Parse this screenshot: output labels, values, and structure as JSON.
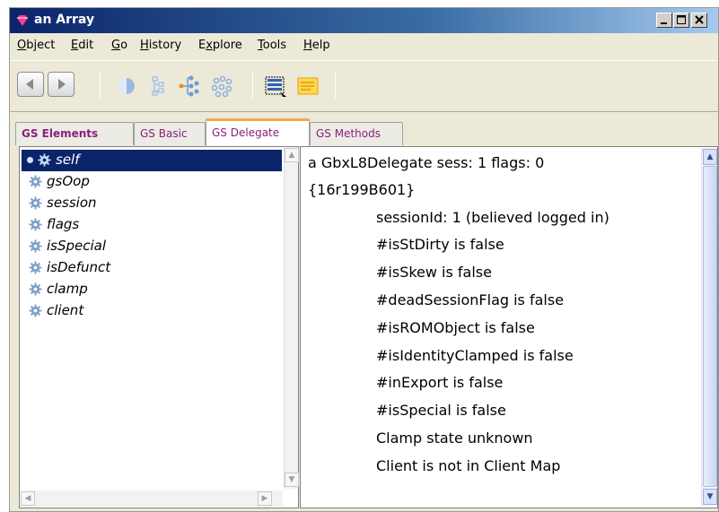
{
  "window": {
    "title": "an Array",
    "controls": {
      "minimize": "_",
      "maximize": "□",
      "close": "X"
    }
  },
  "menu": [
    {
      "label": "Object",
      "mnemonic": "O",
      "rest": "bject"
    },
    {
      "label": "Edit",
      "mnemonic": "E",
      "rest": "dit"
    },
    {
      "label": "Go",
      "mnemonic": "G",
      "rest": "o"
    },
    {
      "label": "History",
      "mnemonic": "H",
      "rest": "istory"
    },
    {
      "label": "Explore",
      "mnemonic": "x",
      "pre": "E",
      "rest": "plore"
    },
    {
      "label": "Tools",
      "mnemonic": "T",
      "rest": "ools"
    },
    {
      "label": "Help",
      "mnemonic": "H",
      "rest": "elp"
    }
  ],
  "toolbar": {
    "icons": [
      "back-arrow-icon",
      "forward-arrow-icon",
      "half-sphere-icon",
      "outline-tree-icon",
      "branch-tree-icon",
      "dotted-cluster-icon",
      "selection-list-icon",
      "note-icon"
    ]
  },
  "tabs": [
    {
      "label": "GS Elements",
      "active": false
    },
    {
      "label": "GS Basic",
      "active": false
    },
    {
      "label": "GS Delegate",
      "active": true
    },
    {
      "label": "GS Methods",
      "active": false
    }
  ],
  "elements": [
    {
      "label": "self",
      "selected": true
    },
    {
      "label": "gsOop",
      "selected": false
    },
    {
      "label": "session",
      "selected": false
    },
    {
      "label": "flags",
      "selected": false
    },
    {
      "label": "isSpecial",
      "selected": false
    },
    {
      "label": "isDefunct",
      "selected": false
    },
    {
      "label": "clamp",
      "selected": false
    },
    {
      "label": "client",
      "selected": false
    }
  ],
  "details": [
    {
      "text": "a GbxL8Delegate sess: 1 flags: 0",
      "indent": false
    },
    {
      "text": "{16r199B601}",
      "indent": false
    },
    {
      "text": "sessionId: 1     (believed logged in)",
      "indent": true
    },
    {
      "text": "#isStDirty is false",
      "indent": true
    },
    {
      "text": "#isSkew is false",
      "indent": true
    },
    {
      "text": "#deadSessionFlag is false",
      "indent": true
    },
    {
      "text": "#isROMObject is false",
      "indent": true
    },
    {
      "text": "#isIdentityClamped is false",
      "indent": true
    },
    {
      "text": "#inExport is false",
      "indent": true
    },
    {
      "text": "#isSpecial is false",
      "indent": true
    },
    {
      "text": "Clamp state unknown",
      "indent": true
    },
    {
      "text": "Client is not in Client Map",
      "indent": true
    }
  ],
  "scroll": {
    "left_up": "▲",
    "left_down": "▼",
    "left_left": "◀",
    "left_right": "▶",
    "right_up": "▲",
    "right_down": "▼"
  }
}
